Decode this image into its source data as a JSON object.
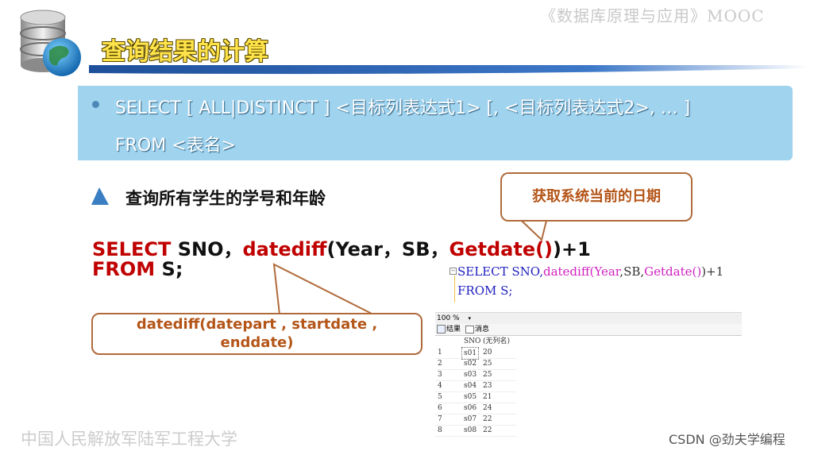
{
  "header": {
    "course": "《数据库原理与应用》MOOC",
    "title": "查询结果的计算"
  },
  "syntax": {
    "line1": "SELECT [ ALL|DISTINCT ] <目标列表达式1> [, <目标列表达式2>, … ]",
    "line2": "FROM <表名>"
  },
  "heading": "查询所有学生的学号和年龄",
  "callouts": {
    "top": "获取系统当前的日期",
    "bottom_line1": "datediff(datepart , startdate ,",
    "bottom_line2": "enddate)"
  },
  "sql": {
    "l1_select": "SELECT",
    "l1_sno": " SNO，",
    "l1_datediff": "datediff",
    "l1_args": "(Year，SB，",
    "l1_getdate": "Getdate()",
    "l1_tail": ")+1",
    "l2_from": "FROM",
    "l2_tail": " S;"
  },
  "result_shot": {
    "code1_select": "SELECT SNO,",
    "code1_datediff": "datediff(",
    "code1_year": "Year",
    "code1_sb": ",SB,",
    "code1_getdate": "Getdate()",
    "code1_tail": ")+1",
    "code2": "FROM S;",
    "zoom": "100 %",
    "tab_results": "结果",
    "tab_messages": "消息",
    "col_sno": "SNO",
    "col_noname": "(无列名)",
    "rows": [
      {
        "n": "1",
        "sno": "s01",
        "age": "20"
      },
      {
        "n": "2",
        "sno": "s02",
        "age": "25"
      },
      {
        "n": "3",
        "sno": "s03",
        "age": "25"
      },
      {
        "n": "4",
        "sno": "s04",
        "age": "23"
      },
      {
        "n": "5",
        "sno": "s05",
        "age": "21"
      },
      {
        "n": "6",
        "sno": "s06",
        "age": "24"
      },
      {
        "n": "7",
        "sno": "s07",
        "age": "22"
      },
      {
        "n": "8",
        "sno": "s08",
        "age": "22"
      }
    ]
  },
  "footer": "中国人民解放军陆军工程大学",
  "watermark": "CSDN @劲夫学编程"
}
